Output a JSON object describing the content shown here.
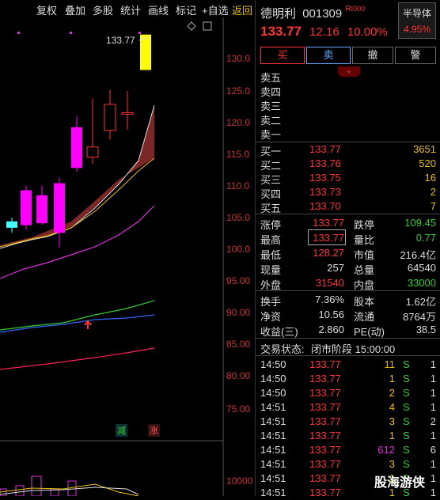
{
  "toolbar": {
    "items": [
      "复权",
      "叠加",
      "多股",
      "统计",
      "画线",
      "标记",
      "+自选",
      "返回"
    ]
  },
  "chart": {
    "y_ticks": [
      "130.0",
      "125.0",
      "120.0",
      "115.0",
      "110.0",
      "105.0",
      "100.0",
      "95.00",
      "90.00",
      "85.00",
      "80.00",
      "75.00"
    ],
    "high_label": "133.77",
    "markers": {
      "reduce": "减",
      "increase": "涨"
    },
    "vol_tick": "10000",
    "candles": [
      {
        "o": 104.4,
        "c": 103.4,
        "h": 105.0,
        "l": 102.6
      },
      {
        "o": 103.8,
        "c": 109.3,
        "h": 110.0,
        "l": 103.1
      },
      {
        "o": 104.1,
        "c": 108.5,
        "h": 110.0,
        "l": 103.9
      },
      {
        "o": 102.6,
        "c": 110.4,
        "h": 111.3,
        "l": 100.3
      },
      {
        "o": 112.8,
        "c": 119.2,
        "h": 120.9,
        "l": 112.2
      },
      {
        "o": 116.1,
        "c": 114.5,
        "h": 123.7,
        "l": 113.4
      },
      {
        "o": 118.7,
        "c": 122.8,
        "h": 125.1,
        "l": 117.3
      },
      {
        "o": 121.5,
        "c": 121.4,
        "h": 124.9,
        "l": 118.8
      },
      {
        "o": 128.2,
        "c": 133.77,
        "h": 133.77,
        "l": 128.2
      }
    ]
  },
  "quote": {
    "name": "德明利",
    "code": "001309",
    "tag": "R",
    "price": "133.77",
    "change": "12.16",
    "pct": "10.00%",
    "sector_name": "半导体",
    "sector_pct": "4.95%",
    "buttons": [
      "买",
      "卖",
      "撤",
      "警"
    ],
    "expand_icon": "chevron-down-icon"
  },
  "asks": [
    {
      "label": "卖五",
      "price": "",
      "vol": ""
    },
    {
      "label": "卖四",
      "price": "",
      "vol": ""
    },
    {
      "label": "卖三",
      "price": "",
      "vol": ""
    },
    {
      "label": "卖二",
      "price": "",
      "vol": ""
    },
    {
      "label": "卖一",
      "price": "",
      "vol": ""
    }
  ],
  "bids": [
    {
      "label": "买一",
      "price": "133.77",
      "vol": "3651"
    },
    {
      "label": "买二",
      "price": "133.76",
      "vol": "520"
    },
    {
      "label": "买三",
      "price": "133.75",
      "vol": "16"
    },
    {
      "label": "买四",
      "price": "133.73",
      "vol": "2"
    },
    {
      "label": "买五",
      "price": "133.70",
      "vol": "7"
    }
  ],
  "stats1": [
    {
      "k1": "涨停",
      "v1": "133.77",
      "c1": "red",
      "k2": "跌停",
      "v2": "109.45",
      "c2": "green"
    },
    {
      "k1": "最高",
      "v1": "133.77",
      "c1": "red",
      "k2": "量比",
      "v2": "0.77",
      "c2": "green"
    },
    {
      "k1": "最低",
      "v1": "128.27",
      "c1": "red",
      "k2": "市值",
      "v2": "216.4亿",
      "c2": "white"
    },
    {
      "k1": "现量",
      "v1": "257",
      "c1": "white",
      "k2": "总量",
      "v2": "64540",
      "c2": "white"
    },
    {
      "k1": "外盘",
      "v1": "31540",
      "c1": "red",
      "k2": "内盘",
      "v2": "33000",
      "c2": "green"
    }
  ],
  "stats2": [
    {
      "k1": "换手",
      "v1": "7.36%",
      "k2": "股本",
      "v2": "1.62亿"
    },
    {
      "k1": "净资",
      "v1": "10.56",
      "k2": "流通",
      "v2": "8764万"
    },
    {
      "k1": "收益(三)",
      "v1": "2.860",
      "k2": "PE(动)",
      "v2": "38.5"
    }
  ],
  "status": {
    "label": "交易状态:",
    "value": "闭市阶段 15:00:00"
  },
  "ticks": [
    {
      "t": "14:50",
      "p": "133.77",
      "v": "11",
      "d": "S",
      "n": "1"
    },
    {
      "t": "14:50",
      "p": "133.77",
      "v": "1",
      "d": "S",
      "n": "1"
    },
    {
      "t": "14:50",
      "p": "133.77",
      "v": "2",
      "d": "S",
      "n": "1"
    },
    {
      "t": "14:51",
      "p": "133.77",
      "v": "4",
      "d": "S",
      "n": "1"
    },
    {
      "t": "14:51",
      "p": "133.77",
      "v": "3",
      "d": "S",
      "n": "2"
    },
    {
      "t": "14:51",
      "p": "133.77",
      "v": "1",
      "d": "S",
      "n": "1"
    },
    {
      "t": "14:51",
      "p": "133.77",
      "v": "612",
      "d": "S",
      "n": "6"
    },
    {
      "t": "14:51",
      "p": "133.77",
      "v": "3",
      "d": "S",
      "n": "1"
    },
    {
      "t": "14:51",
      "p": "133.77",
      "v": "1",
      "d": "S",
      "n": "1"
    },
    {
      "t": "14:51",
      "p": "133.77",
      "v": "1",
      "d": "S",
      "n": "1"
    }
  ],
  "watermark": "股海游侠",
  "colors": {
    "up": "#ff3333",
    "down": "#33cc33",
    "candle_up": "#ff00ff",
    "candle_down": "#44ffff",
    "last_candle": "#ffff00"
  }
}
